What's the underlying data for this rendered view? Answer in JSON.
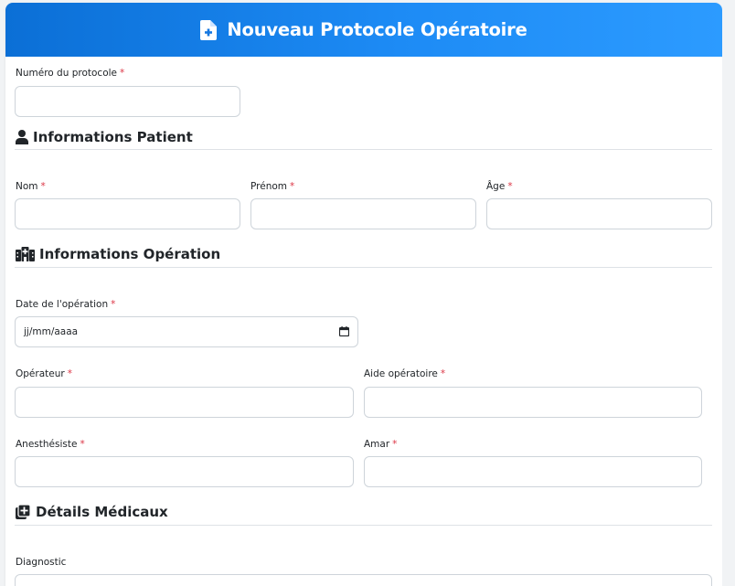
{
  "header": {
    "title": "Nouveau Protocole Opératoire",
    "icon": "file-medical-icon"
  },
  "protocol_number": {
    "label": "Numéro du protocole",
    "required_mark": "*",
    "value": "",
    "placeholder": ""
  },
  "patient_section": {
    "title": "Informations Patient",
    "icon": "user-icon",
    "fields": [
      {
        "label": "Nom",
        "required_mark": "*",
        "value": ""
      },
      {
        "label": "Prénom",
        "required_mark": "*",
        "value": ""
      },
      {
        "label": "Âge",
        "required_mark": "*",
        "value": ""
      }
    ]
  },
  "operation_section": {
    "title": "Informations Opération",
    "icon": "hospital-icon",
    "date": {
      "label": "Date de l'opération",
      "required_mark": "*",
      "placeholder": "jj/mm/aaaa",
      "icon": "calendar-icon"
    },
    "fields": [
      {
        "label": "Opérateur",
        "required_mark": "*",
        "value": ""
      },
      {
        "label": "Aide opératoire",
        "required_mark": "*",
        "value": ""
      },
      {
        "label": "Anesthésiste",
        "required_mark": "*",
        "value": ""
      },
      {
        "label": "Amar",
        "required_mark": "*",
        "value": ""
      }
    ]
  },
  "medical_section": {
    "title": "Détails Médicaux",
    "icon": "notes-medical-icon",
    "diagnostic": {
      "label": "Diagnostic",
      "value": ""
    }
  },
  "colors": {
    "header_start": "#0b6fd6",
    "header_end": "#2c9bff",
    "required": "#dc3545",
    "border": "#ced4da"
  }
}
